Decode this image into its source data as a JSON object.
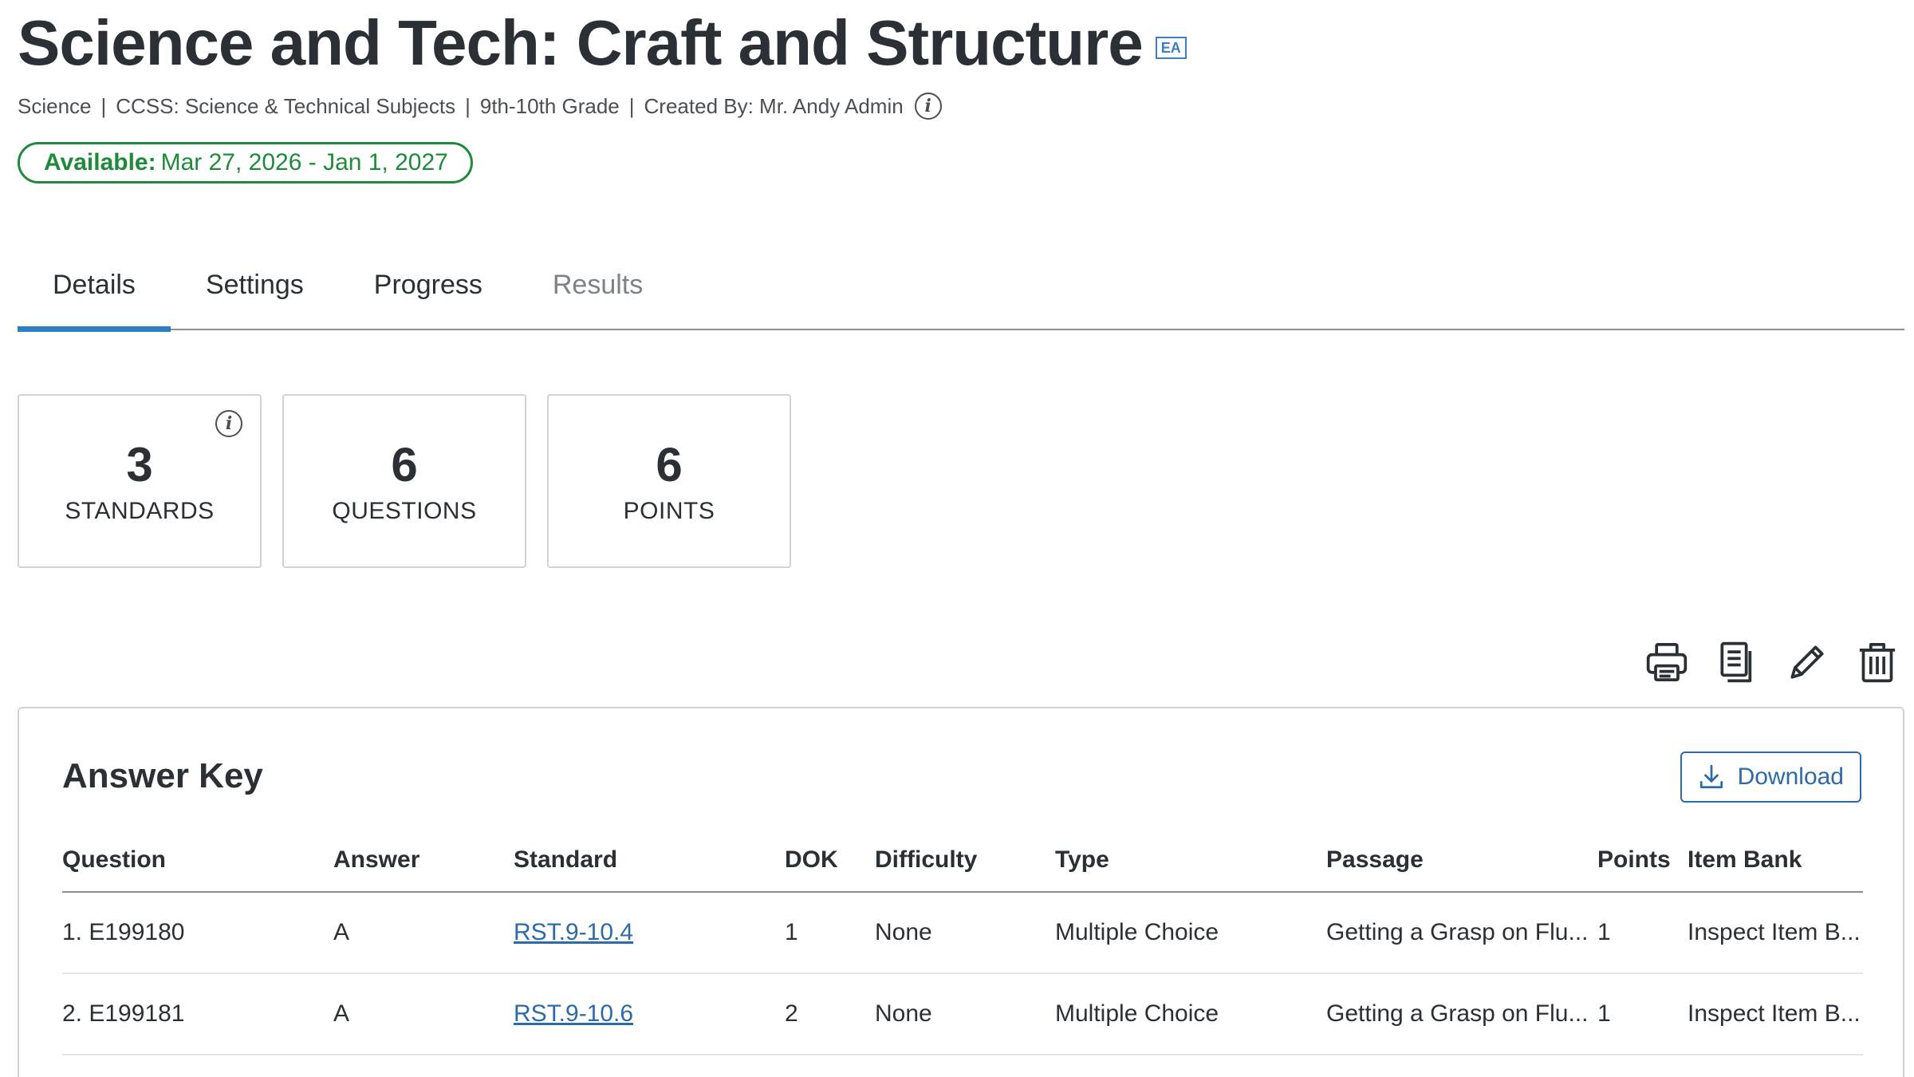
{
  "header": {
    "title": "Science and Tech: Craft and Structure",
    "badge": "EA",
    "meta": [
      "Science",
      "CCSS: Science & Technical Subjects",
      "9th-10th Grade",
      "Created By: Mr. Andy Admin"
    ],
    "meta_separator": "|",
    "availability_label": "Available:",
    "availability_value": "Mar 27, 2026 - Jan 1, 2027"
  },
  "tabs": [
    {
      "label": "Details",
      "state": "active"
    },
    {
      "label": "Settings",
      "state": "normal"
    },
    {
      "label": "Progress",
      "state": "normal"
    },
    {
      "label": "Results",
      "state": "disabled"
    }
  ],
  "stats": [
    {
      "value": "3",
      "label": "STANDARDS"
    },
    {
      "value": "6",
      "label": "QUESTIONS"
    },
    {
      "value": "6",
      "label": "POINTS"
    }
  ],
  "toolbar_icons": [
    "printer-icon",
    "copy-icon",
    "pencil-icon",
    "trash-icon"
  ],
  "answer_key": {
    "title": "Answer Key",
    "download_label": "Download",
    "columns": [
      "Question",
      "Answer",
      "Standard",
      "DOK",
      "Difficulty",
      "Type",
      "Passage",
      "Points",
      "Item Bank"
    ],
    "rows": [
      [
        "1. E199180",
        "A",
        "RST.9-10.4",
        "1",
        "None",
        "Multiple Choice",
        "Getting a Grasp on Flu...",
        "1",
        "Inspect Item B..."
      ],
      [
        "2. E199181",
        "A",
        "RST.9-10.6",
        "2",
        "None",
        "Multiple Choice",
        "Getting a Grasp on Flu...",
        "1",
        "Inspect Item B..."
      ]
    ]
  },
  "colors": {
    "accent": "#2d7fc1",
    "available": "#1f8a3c",
    "link": "#2d6aa8"
  }
}
